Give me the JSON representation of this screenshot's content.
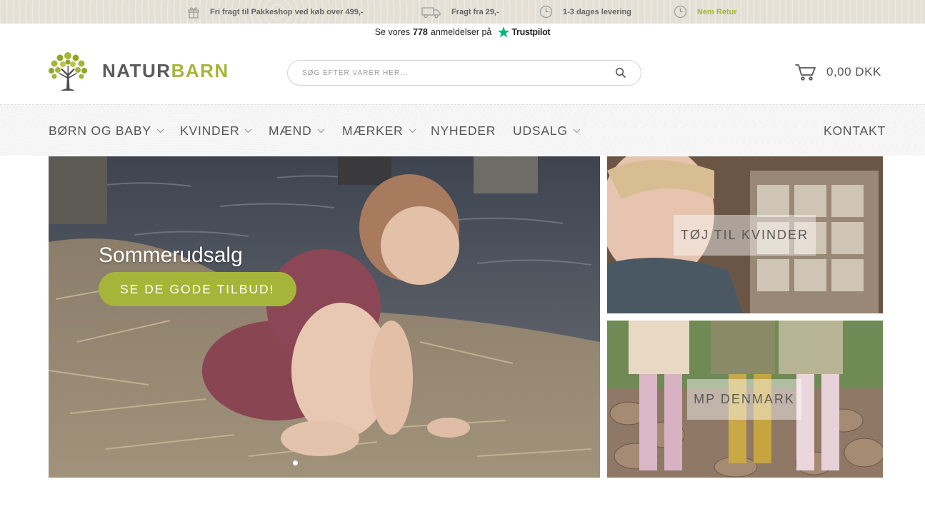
{
  "topbar": {
    "usps": [
      {
        "text": "Fri fragt til Pakkeshop ved køb over 499,-",
        "icon": "gift-icon"
      },
      {
        "text": "Fragt fra 29,-",
        "icon": "truck-icon"
      },
      {
        "text": "1-3 dages levering",
        "icon": "clock-icon"
      },
      {
        "text": "Nem Retur",
        "icon": "clock-icon"
      }
    ]
  },
  "trustpilot": {
    "prefix": "Se vores",
    "count": "778",
    "suffix": "anmeldelser på",
    "brand": "Trustpilot"
  },
  "logo": {
    "part1": "NATUR",
    "part2": "BARN"
  },
  "search": {
    "placeholder": "SØG EFTER VARER HER...",
    "value": ""
  },
  "cart": {
    "total": "0,00 DKK"
  },
  "nav": {
    "items": [
      {
        "label": "BØRN OG BABY",
        "has_dropdown": true
      },
      {
        "label": "KVINDER",
        "has_dropdown": true
      },
      {
        "label": "MÆND",
        "has_dropdown": true
      },
      {
        "label": "MÆRKER",
        "has_dropdown": true
      },
      {
        "label": "NYHEDER",
        "has_dropdown": false
      },
      {
        "label": "UDSALG",
        "has_dropdown": true
      }
    ],
    "contact": "KONTAKT"
  },
  "hero": {
    "title": "Sommerudsalg",
    "button": "SE DE GODE TILBUD!",
    "slide_index": 1,
    "slide_count": 2
  },
  "tiles": [
    {
      "label": "TØJ TIL KVINDER"
    },
    {
      "label": "MP DENMARK"
    }
  ],
  "colors": {
    "accent": "#a5b53a",
    "text": "#555555",
    "topbar": "#e4e0d6"
  }
}
